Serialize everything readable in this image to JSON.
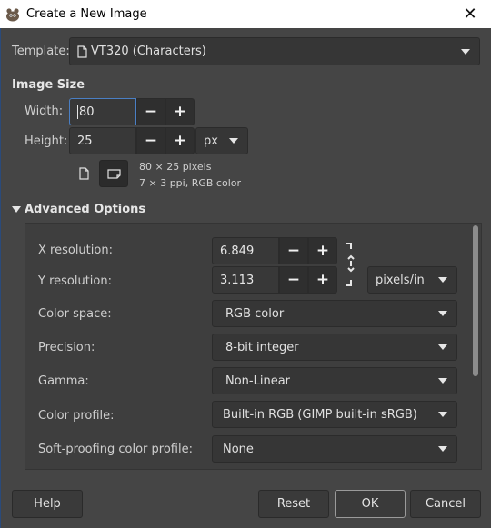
{
  "window": {
    "title": "Create a New Image",
    "close_glyph": "✕"
  },
  "template": {
    "label": "Template:",
    "value": "VT320 (Characters)"
  },
  "image_size": {
    "heading": "Image Size",
    "width_label": "Width:",
    "width_value": "80",
    "height_label": "Height:",
    "height_value": "25",
    "unit": "px",
    "minus": "−",
    "plus": "+",
    "info_line1": "80 × 25 pixels",
    "info_line2": "7 × 3 ppi, RGB color"
  },
  "advanced": {
    "heading": "Advanced Options",
    "x_res_label": "X resolution:",
    "x_res_value": "6.849",
    "y_res_label": "Y resolution:",
    "y_res_value": "3.113",
    "res_unit": "pixels/in",
    "color_space_label": "Color space:",
    "color_space_value": "RGB color",
    "precision_label": "Precision:",
    "precision_value": "8-bit integer",
    "gamma_label": "Gamma:",
    "gamma_value": "Non-Linear",
    "color_profile_label": "Color profile:",
    "color_profile_value": "Built-in RGB (GIMP built-in sRGB)",
    "soft_proof_label": "Soft-proofing color profile:",
    "soft_proof_value": "None"
  },
  "buttons": {
    "help": "Help",
    "reset": "Reset",
    "ok": "OK",
    "cancel": "Cancel"
  },
  "colors": {
    "background": "#454545",
    "field": "#363636",
    "focus": "#4a7fc4"
  }
}
